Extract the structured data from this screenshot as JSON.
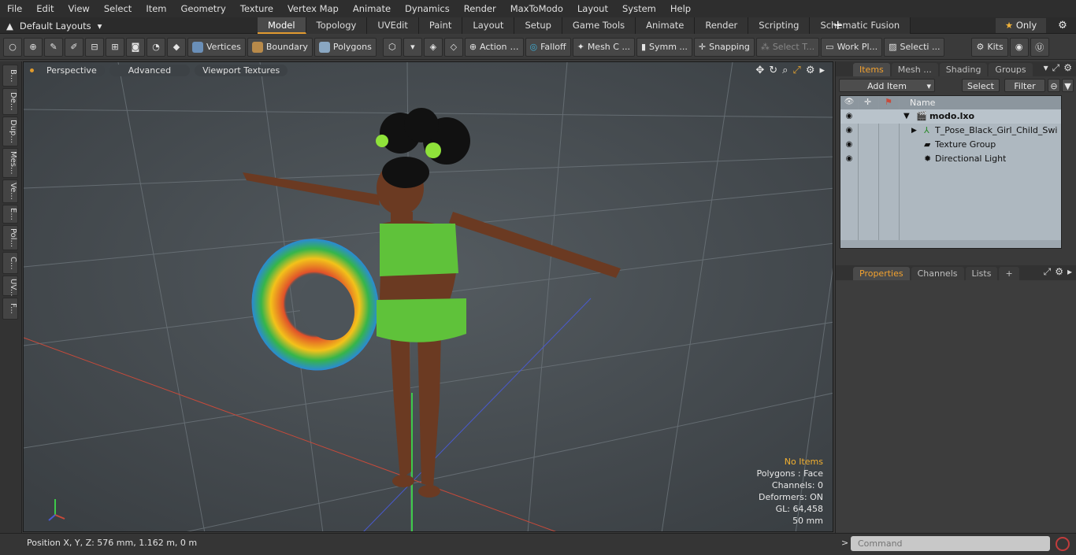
{
  "menu": [
    "File",
    "Edit",
    "View",
    "Select",
    "Item",
    "Geometry",
    "Texture",
    "Vertex Map",
    "Animate",
    "Dynamics",
    "Render",
    "MaxToModo",
    "Layout",
    "System",
    "Help"
  ],
  "layout_selector": "Default Layouts",
  "tabs": [
    {
      "label": "Model",
      "active": true
    },
    {
      "label": "Topology"
    },
    {
      "label": "UVEdit"
    },
    {
      "label": "Paint"
    },
    {
      "label": "Layout"
    },
    {
      "label": "Setup"
    },
    {
      "label": "Game Tools"
    },
    {
      "label": "Animate"
    },
    {
      "label": "Render"
    },
    {
      "label": "Scripting"
    },
    {
      "label": "Schematic Fusion"
    }
  ],
  "only_label": "Only",
  "toolbar": {
    "vertices": "Vertices",
    "boundary": "Boundary",
    "polygons": "Polygons",
    "action": "Action",
    "falloff": "Falloff",
    "mesh": "Mesh C ...",
    "symm": "Symm ...",
    "snapping": "Snapping",
    "select_t": "Select T...",
    "workpl": "Work Pl...",
    "selecti": "Selecti ...",
    "kits": "Kits"
  },
  "left_tabs": [
    "B...",
    "De...",
    "Dup...",
    "Mes...",
    "Ve...",
    "E...",
    "Pol...",
    "C...",
    "UV...",
    "F..."
  ],
  "viewport": {
    "pills": [
      "Perspective",
      "Advanced",
      "Viewport Textures"
    ],
    "info": {
      "no_items": "No Items",
      "polygons": "Polygons : Face",
      "channels": "Channels: 0",
      "deformers": "Deformers: ON",
      "gl": "GL: 64,458",
      "scale": "50 mm"
    }
  },
  "status": "Position X, Y, Z:   576 mm, 1.162 m, 0 m",
  "items_panel": {
    "tabs": [
      {
        "label": "Items",
        "active": true
      },
      {
        "label": "Mesh ..."
      },
      {
        "label": "Shading"
      },
      {
        "label": "Groups"
      }
    ],
    "add_item": "Add Item",
    "select": "Select",
    "filter": "Filter",
    "name_header": "Name",
    "rows": [
      "modo.lxo",
      "T_Pose_Black_Girl_Child_Swi ...",
      "Texture Group",
      "Directional Light"
    ]
  },
  "props_panel": {
    "tabs": [
      {
        "label": "Properties",
        "active": true
      },
      {
        "label": "Channels"
      },
      {
        "label": "Lists"
      }
    ]
  },
  "command_placeholder": "Command",
  "colors": {
    "accent": "#e29a2f",
    "tree_bg": "#aeb8c0",
    "viewport_bg": "#4a5055"
  }
}
